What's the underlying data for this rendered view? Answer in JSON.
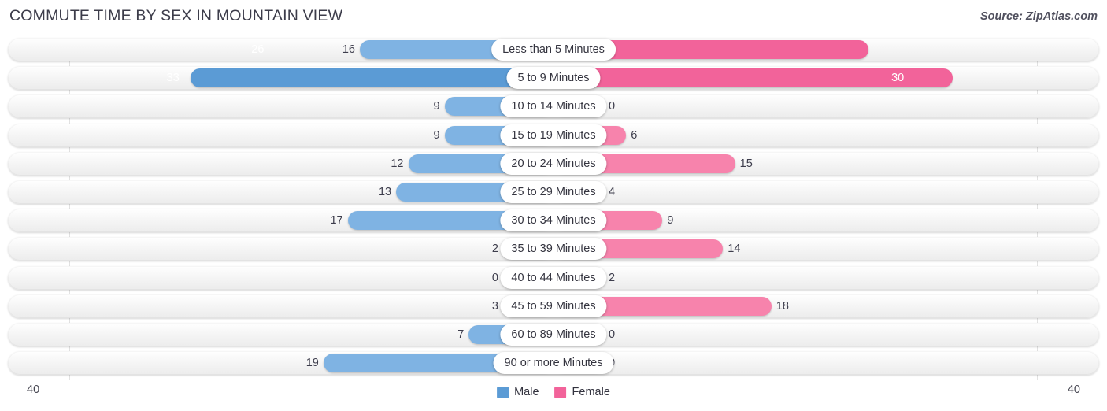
{
  "header": {
    "title": "COMMUTE TIME BY SEX IN MOUNTAIN VIEW",
    "source": "Source: ZipAtlas.com"
  },
  "axis": {
    "left_tick": "40",
    "right_tick": "40",
    "max": 40
  },
  "legend": {
    "items": [
      {
        "label": "Male",
        "color": "#5b9bd5"
      },
      {
        "label": "Female",
        "color": "#f2639a"
      }
    ]
  },
  "colors": {
    "male_light": "#7fb3e3",
    "male_strong": "#5b9bd5",
    "female_light": "#f783ac",
    "female_strong": "#f2639a"
  },
  "chart_data": {
    "type": "bar",
    "title": "COMMUTE TIME BY SEX IN MOUNTAIN VIEW",
    "subtitle": "Source: ZipAtlas.com",
    "orientation": "horizontal-diverging",
    "xlabel": "",
    "ylabel": "",
    "xlim": [
      40,
      40
    ],
    "grid": false,
    "legend_position": "bottom-center",
    "categories": [
      "Less than 5 Minutes",
      "5 to 9 Minutes",
      "10 to 14 Minutes",
      "15 to 19 Minutes",
      "20 to 24 Minutes",
      "25 to 29 Minutes",
      "30 to 34 Minutes",
      "35 to 39 Minutes",
      "40 to 44 Minutes",
      "45 to 59 Minutes",
      "60 to 89 Minutes",
      "90 or more Minutes"
    ],
    "series": [
      {
        "name": "Male",
        "side": "left",
        "values": [
          16,
          30,
          9,
          9,
          12,
          13,
          17,
          2,
          0,
          3,
          7,
          19
        ]
      },
      {
        "name": "Female",
        "side": "right",
        "values": [
          26,
          33,
          0,
          6,
          15,
          4,
          9,
          14,
          2,
          18,
          0,
          0
        ]
      }
    ]
  }
}
